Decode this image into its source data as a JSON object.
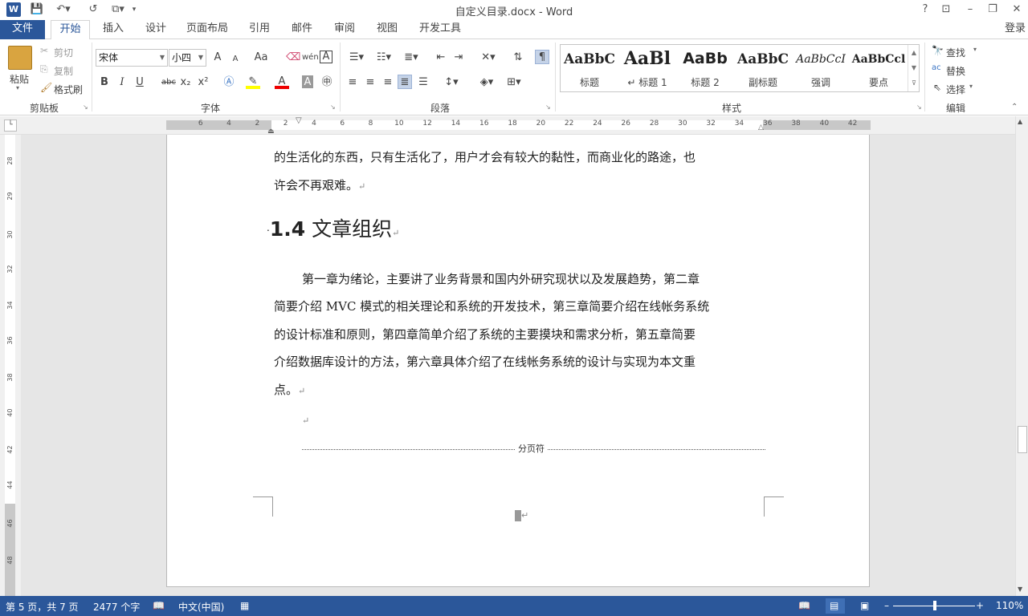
{
  "window": {
    "title": "自定义目录.docx - Word",
    "help": "?",
    "login": "登录"
  },
  "tabs": [
    {
      "label": "文件"
    },
    {
      "label": "开始"
    },
    {
      "label": "插入"
    },
    {
      "label": "设计"
    },
    {
      "label": "页面布局"
    },
    {
      "label": "引用"
    },
    {
      "label": "邮件"
    },
    {
      "label": "审阅"
    },
    {
      "label": "视图"
    },
    {
      "label": "开发工具"
    }
  ],
  "clipboard": {
    "paste": "粘贴",
    "cut": "剪切",
    "copy": "复制",
    "format_painter": "格式刷",
    "group": "剪贴板"
  },
  "font": {
    "name": "宋体",
    "size": "小四",
    "group": "字体",
    "aa": "Aa",
    "pinyin": "wén",
    "grow": "A",
    "shrink": "A",
    "B": "B",
    "I": "I",
    "U": "U",
    "abc": "abc",
    "sub": "x₂",
    "sup": "x²"
  },
  "paragraph": {
    "group": "段落"
  },
  "styles": {
    "group": "样式",
    "items": [
      {
        "sample": "AaBbC",
        "name": "标题"
      },
      {
        "sample": "AaBl",
        "name": "↵ 标题 1"
      },
      {
        "sample": "AaBb",
        "name": "标题 2"
      },
      {
        "sample": "AaBbC",
        "name": "副标题"
      },
      {
        "sample": "AaBbCcI",
        "name": "强调"
      },
      {
        "sample": "AaBbCcl",
        "name": "要点"
      }
    ]
  },
  "editing": {
    "find": "查找",
    "replace": "替换",
    "select": "选择",
    "group": "编辑"
  },
  "ruler": {
    "h_left": [
      "6",
      "4",
      "2"
    ],
    "h_right": [
      "2",
      "4",
      "6",
      "8",
      "10",
      "12",
      "14",
      "16",
      "18",
      "20",
      "22",
      "24",
      "26",
      "28",
      "30",
      "32",
      "34",
      "36",
      "38",
      "40",
      "42"
    ],
    "v": [
      "28",
      "29",
      "30",
      "32",
      "34",
      "36",
      "38",
      "40",
      "42",
      "44",
      "46",
      "48"
    ]
  },
  "document": {
    "line1": "的生活化的东西，只有生活化了，用户才会有较大的黏性，而商业化的路途，也",
    "line2": "许会不再艰难。",
    "heading_num": "1.4",
    "heading_text": "文章组织",
    "p1": "第一章为绪论，主要讲了业务背景和国内外研究现状以及发展趋势，第二章",
    "p2": "简要介绍 MVC 模式的相关理论和系统的开发技术，第三章简要介绍在线帐务系统",
    "p3": "的设计标准和原则，第四章简单介绍了系统的主要摸块和需求分析，第五章简要",
    "p4": "介绍数据库设计的方法，第六章具体介绍了在线帐务系统的设计与实现为本文重",
    "p5": "点。",
    "page_break": "分页符",
    "return_mark": "↵"
  },
  "status": {
    "page": "第 5 页，共 7 页",
    "words": "2477 个字",
    "lang": "中文(中国)",
    "zoom": "110%"
  }
}
